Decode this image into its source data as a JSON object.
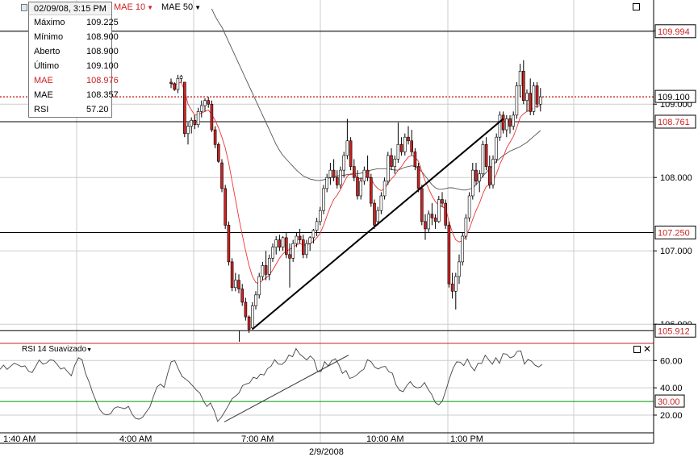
{
  "info": {
    "header": "02/09/08, 3:15 PM",
    "rows": [
      {
        "label": "Máximo",
        "value": "109.225",
        "red": false
      },
      {
        "label": "Mínimo",
        "value": "108.900",
        "red": false
      },
      {
        "label": "Aberto",
        "value": "108.900",
        "red": false
      },
      {
        "label": "Último",
        "value": "109.100",
        "red": false
      },
      {
        "label": "MAE",
        "value": "108.976",
        "red": true
      },
      {
        "label": "MAE",
        "value": "108.357",
        "red": false
      },
      {
        "label": "RSI",
        "value": "57.20",
        "red": false
      }
    ]
  },
  "legends": {
    "mae10": "MAE 10",
    "mae50": "MAE 50",
    "rsi": "RSI 14 Suavizado"
  },
  "colors": {
    "grid": "#cccccc",
    "up_body": "#ffffff",
    "down_body": "#cc2222",
    "wick": "#000000",
    "mae10": "#ee3333",
    "mae50": "#555555",
    "last_price": "#cc0000",
    "level_label": "#cc2222",
    "rsi_30_line": "#009900"
  },
  "chart_data": [
    {
      "type": "candlestick",
      "title": "",
      "date_label": "2/9/2008",
      "x_tick_labels": [
        "1:40 AM",
        "4:00 AM",
        "7:00 AM",
        "10:00 AM",
        "1:00 PM"
      ],
      "y_ticks": [
        106.0,
        107.0,
        108.0,
        109.0,
        110.0
      ],
      "ylim": [
        105.75,
        110.42
      ],
      "grid": true,
      "last_price": 109.1,
      "horizontal_levels": [
        109.994,
        108.761,
        107.25,
        105.912
      ],
      "trendline": {
        "from": 105.93,
        "to": 108.8
      },
      "candles": [
        [
          109.3,
          109.35,
          109.22,
          109.28
        ],
        [
          109.28,
          109.3,
          109.18,
          109.2
        ],
        [
          109.2,
          109.4,
          109.15,
          109.35
        ],
        [
          109.35,
          109.4,
          109.3,
          109.38
        ],
        [
          109.3,
          109.3,
          108.55,
          108.6
        ],
        [
          108.6,
          108.75,
          108.45,
          108.7
        ],
        [
          108.7,
          108.82,
          108.6,
          108.78
        ],
        [
          108.78,
          108.85,
          108.66,
          108.72
        ],
        [
          108.72,
          108.95,
          108.68,
          108.9
        ],
        [
          108.9,
          109.05,
          108.82,
          108.98
        ],
        [
          108.98,
          109.08,
          108.9,
          109.05
        ],
        [
          109.05,
          109.1,
          108.95,
          109.0
        ],
        [
          109.0,
          109.05,
          108.62,
          108.65
        ],
        [
          108.65,
          108.7,
          108.4,
          108.45
        ],
        [
          108.45,
          108.48,
          108.2,
          108.22
        ],
        [
          108.2,
          108.25,
          107.8,
          107.85
        ],
        [
          107.85,
          107.9,
          107.3,
          107.35
        ],
        [
          107.35,
          107.4,
          106.8,
          106.85
        ],
        [
          106.85,
          106.9,
          106.45,
          106.5
        ],
        [
          106.5,
          106.7,
          106.45,
          106.6
        ],
        [
          106.6,
          106.68,
          106.42,
          106.48
        ],
        [
          106.48,
          106.55,
          106.25,
          106.3
        ],
        [
          106.3,
          106.36,
          106.05,
          106.1
        ],
        [
          106.1,
          106.12,
          105.88,
          105.93
        ],
        [
          105.95,
          106.3,
          105.93,
          106.25
        ],
        [
          106.25,
          106.45,
          106.2,
          106.4
        ],
        [
          106.4,
          106.7,
          106.35,
          106.65
        ],
        [
          106.65,
          106.85,
          106.6,
          106.8
        ],
        [
          106.8,
          107.0,
          106.6,
          106.68
        ],
        [
          106.68,
          106.95,
          106.6,
          106.9
        ],
        [
          106.9,
          107.1,
          106.85,
          107.05
        ],
        [
          107.05,
          107.2,
          106.95,
          107.15
        ],
        [
          107.15,
          107.22,
          107.0,
          107.05
        ],
        [
          107.05,
          107.2,
          107.0,
          107.18
        ],
        [
          107.18,
          107.25,
          106.9,
          106.95
        ],
        [
          106.95,
          107.1,
          106.5,
          106.9
        ],
        [
          106.9,
          107.15,
          106.85,
          107.1
        ],
        [
          107.1,
          107.25,
          107.05,
          107.2
        ],
        [
          107.2,
          107.3,
          107.1,
          107.15
        ],
        [
          107.15,
          107.22,
          106.9,
          106.95
        ],
        [
          106.95,
          107.15,
          106.9,
          107.1
        ],
        [
          107.1,
          107.2,
          107.0,
          107.18
        ],
        [
          107.18,
          107.3,
          107.1,
          107.28
        ],
        [
          107.28,
          107.45,
          107.2,
          107.4
        ],
        [
          107.4,
          107.6,
          107.35,
          107.55
        ],
        [
          107.55,
          107.9,
          107.5,
          107.85
        ],
        [
          107.85,
          108.05,
          107.8,
          108.0
        ],
        [
          108.0,
          108.2,
          107.9,
          108.1
        ],
        [
          108.1,
          108.25,
          107.95,
          108.0
        ],
        [
          108.0,
          108.1,
          107.85,
          107.9
        ],
        [
          107.9,
          108.15,
          107.85,
          108.1
        ],
        [
          108.1,
          108.35,
          108.0,
          108.3
        ],
        [
          108.3,
          108.8,
          108.25,
          108.5
        ],
        [
          108.5,
          108.55,
          108.1,
          108.15
        ],
        [
          108.15,
          108.25,
          107.95,
          108.0
        ],
        [
          108.0,
          108.1,
          107.7,
          107.75
        ],
        [
          107.75,
          108.0,
          107.7,
          107.95
        ],
        [
          107.95,
          108.15,
          107.9,
          108.1
        ],
        [
          108.1,
          108.3,
          107.95,
          108.0
        ],
        [
          108.0,
          108.05,
          107.6,
          107.65
        ],
        [
          107.65,
          107.7,
          107.3,
          107.35
        ],
        [
          107.4,
          107.6,
          107.35,
          107.55
        ],
        [
          107.55,
          107.8,
          107.5,
          107.75
        ],
        [
          107.75,
          108.0,
          107.7,
          107.95
        ],
        [
          107.95,
          108.35,
          107.9,
          108.3
        ],
        [
          108.3,
          108.4,
          108.1,
          108.15
        ],
        [
          108.15,
          108.3,
          108.05,
          108.25
        ],
        [
          108.25,
          108.75,
          108.2,
          108.45
        ],
        [
          108.45,
          108.55,
          108.3,
          108.35
        ],
        [
          108.35,
          108.6,
          108.3,
          108.55
        ],
        [
          108.55,
          108.7,
          108.45,
          108.5
        ],
        [
          108.5,
          108.65,
          108.3,
          108.35
        ],
        [
          108.35,
          108.4,
          108.1,
          108.15
        ],
        [
          108.15,
          108.2,
          107.8,
          107.85
        ],
        [
          107.85,
          107.9,
          107.35,
          107.4
        ],
        [
          107.4,
          107.5,
          107.15,
          107.3
        ],
        [
          107.3,
          107.55,
          107.25,
          107.5
        ],
        [
          107.5,
          107.65,
          107.35,
          107.45
        ],
        [
          107.45,
          107.5,
          107.3,
          107.4
        ],
        [
          107.4,
          107.75,
          107.38,
          107.7
        ],
        [
          107.7,
          107.8,
          107.6,
          107.65
        ],
        [
          107.65,
          107.7,
          107.3,
          107.35
        ],
        [
          107.35,
          107.4,
          106.5,
          106.55
        ],
        [
          106.55,
          106.7,
          106.35,
          106.45
        ],
        [
          106.45,
          106.7,
          106.2,
          106.65
        ],
        [
          106.65,
          106.95,
          106.55,
          106.85
        ],
        [
          106.85,
          107.25,
          106.8,
          107.2
        ],
        [
          107.2,
          107.5,
          107.15,
          107.45
        ],
        [
          107.45,
          107.8,
          107.4,
          107.75
        ],
        [
          107.75,
          108.2,
          107.7,
          108.1
        ],
        [
          108.1,
          108.2,
          107.9,
          107.95
        ],
        [
          107.95,
          108.1,
          107.8,
          108.05
        ],
        [
          108.05,
          108.5,
          108.0,
          108.45
        ],
        [
          108.45,
          108.55,
          108.1,
          108.15
        ],
        [
          108.15,
          108.3,
          107.85,
          107.9
        ],
        [
          107.9,
          108.3,
          107.85,
          108.25
        ],
        [
          108.25,
          108.6,
          108.2,
          108.55
        ],
        [
          108.55,
          108.9,
          108.5,
          108.85
        ],
        [
          108.85,
          108.9,
          108.6,
          108.65
        ],
        [
          108.65,
          108.85,
          108.55,
          108.8
        ],
        [
          108.8,
          108.85,
          108.6,
          108.7
        ],
        [
          108.7,
          108.9,
          108.65,
          108.85
        ],
        [
          108.85,
          109.3,
          108.8,
          109.25
        ],
        [
          109.25,
          109.55,
          109.1,
          109.45
        ],
        [
          109.45,
          109.6,
          109.0,
          109.05
        ],
        [
          109.05,
          109.2,
          108.9,
          109.15
        ],
        [
          109.15,
          109.35,
          108.85,
          108.9
        ],
        [
          108.9,
          109.3,
          108.85,
          109.25
        ],
        [
          109.25,
          109.3,
          108.95,
          109.0
        ],
        [
          109.0,
          109.22,
          108.9,
          109.1
        ]
      ],
      "mae10": [
        109.28,
        109.26,
        109.28,
        109.3,
        109.18,
        109.0,
        108.92,
        108.85,
        108.86,
        108.88,
        108.9,
        108.92,
        108.86,
        108.78,
        108.68,
        108.55,
        108.4,
        108.2,
        107.95,
        107.7,
        107.45,
        107.22,
        107.0,
        106.8,
        106.65,
        106.57,
        106.55,
        106.6,
        106.63,
        106.67,
        106.74,
        106.82,
        106.9,
        106.96,
        107.0,
        107.02,
        107.05,
        107.08,
        107.1,
        107.08,
        107.08,
        107.1,
        107.13,
        107.18,
        107.24,
        107.35,
        107.48,
        107.6,
        107.7,
        107.76,
        107.84,
        107.93,
        108.02,
        108.05,
        108.05,
        108.0,
        107.98,
        108.0,
        108.02,
        107.98,
        107.9,
        107.85,
        107.82,
        107.85,
        107.92,
        107.98,
        108.03,
        108.1,
        108.15,
        108.22,
        108.28,
        108.3,
        108.28,
        108.22,
        108.08,
        107.95,
        107.85,
        107.75,
        107.67,
        107.62,
        107.6,
        107.58,
        107.4,
        107.25,
        107.15,
        107.12,
        107.14,
        107.2,
        107.3,
        107.43,
        107.55,
        107.65,
        107.78,
        107.88,
        107.9,
        107.95,
        108.05,
        108.18,
        108.28,
        108.4,
        108.48,
        108.56,
        108.68,
        108.82,
        108.87,
        108.9,
        108.92,
        108.96,
        108.97,
        108.98
      ],
      "mae50": [
        110.3,
        110.2,
        110.12,
        110.05,
        109.95,
        109.85,
        109.75,
        109.65,
        109.55,
        109.45,
        109.35,
        109.25,
        109.15,
        109.05,
        108.95,
        108.85,
        108.75,
        108.65,
        108.55,
        108.45,
        108.37,
        108.3,
        108.25,
        108.2,
        108.15,
        108.1,
        108.06,
        108.02,
        108.0,
        107.98,
        107.97,
        107.96,
        107.96,
        107.97,
        107.98,
        108.0,
        108.01,
        108.02,
        108.03,
        108.03,
        108.04,
        108.04,
        108.05,
        108.05,
        108.06,
        108.07,
        108.08,
        108.1,
        108.11,
        108.12,
        108.12,
        108.12,
        108.12,
        108.11,
        108.1,
        108.1,
        108.12,
        108.14,
        108.15,
        108.16,
        108.15,
        108.12,
        108.08,
        108.02,
        107.96,
        107.9,
        107.86,
        107.84,
        107.84,
        107.85,
        107.86,
        107.86,
        107.85,
        107.84,
        107.83,
        107.83,
        107.84,
        107.86,
        107.9,
        107.96,
        108.02,
        108.07,
        108.12,
        108.17,
        108.22,
        108.26,
        108.3,
        108.33,
        108.36,
        108.38,
        108.4,
        108.42,
        108.45,
        108.48,
        108.52,
        108.56,
        108.6,
        108.64
      ]
    },
    {
      "type": "line",
      "title": "",
      "legend": "RSI 14 Suavizado",
      "y_ticks": [
        20,
        40,
        60
      ],
      "ylim": [
        7,
        72
      ],
      "reference_level": 30,
      "series": [
        {
          "name": "RSI",
          "values": [
            53.5,
            56.6,
            53.5,
            55.9,
            58.0,
            56.9,
            55.5,
            56.1,
            52.2,
            51.2,
            55.7,
            60.4,
            57.4,
            58.1,
            60.4,
            60.1,
            57.3,
            53.7,
            54.7,
            51.6,
            48.9,
            56.8,
            62.1,
            60.6,
            50.3,
            44.1,
            36.3,
            29.7,
            23.9,
            20.9,
            20.1,
            21.0,
            25.0,
            26.1,
            25.3,
            24.7,
            26.4,
            20.8,
            17.6,
            17.0,
            18.5,
            22.3,
            25.9,
            33.6,
            40.6,
            42.7,
            40.4,
            50.6,
            59.2,
            59.9,
            53.8,
            48.4,
            46.5,
            44.3,
            41.5,
            38.4,
            36.2,
            30.5,
            26.3,
            28.9,
            23.3,
            15.4,
            18.2,
            22.4,
            26.9,
            31.9,
            33.9,
            36.2,
            41.6,
            42.8,
            43.7,
            47.8,
            46.7,
            50.0,
            49.4,
            54.1,
            55.9,
            60.6,
            57.4,
            57.1,
            59.5,
            64.0,
            62.8,
            68.7,
            64.8,
            62.6,
            60.4,
            63.4,
            60.7,
            52.0,
            51.9,
            59.2,
            56.0,
            60.0,
            61.3,
            56.8,
            50.5,
            52.7,
            46.9,
            47.8,
            49.4,
            51.9,
            53.6,
            60.6,
            59.2,
            55.2,
            53.8,
            55.3,
            55.7,
            51.8,
            50.6,
            42.2,
            38.2,
            37.2,
            41.5,
            44.5,
            41.1,
            39.9,
            40.6,
            43.9,
            38.9,
            35.2,
            29.2,
            27.5,
            30.4,
            38.2,
            47.0,
            54.4,
            59.0,
            58.8,
            56.3,
            61.2,
            55.8,
            52.5,
            58.0,
            57.8,
            63.9,
            60.5,
            57.3,
            62.1,
            58.0,
            65.1,
            64.7,
            62.0,
            62.9,
            66.8,
            67.0,
            57.3,
            60.8,
            59.5,
            56.5,
            55.3,
            57.2
          ]
        }
      ]
    }
  ],
  "axis": {
    "price_labels": [
      "110.000",
      "108.000",
      "107.000",
      "106.000",
      "109.000"
    ],
    "level_labels": [
      "109.994",
      "108.761",
      "107.250",
      "105.912"
    ],
    "last_price_label": "109.100",
    "rsi_labels": [
      "60.00",
      "40.00",
      "20.00"
    ],
    "rsi_level_label": "30.00"
  }
}
